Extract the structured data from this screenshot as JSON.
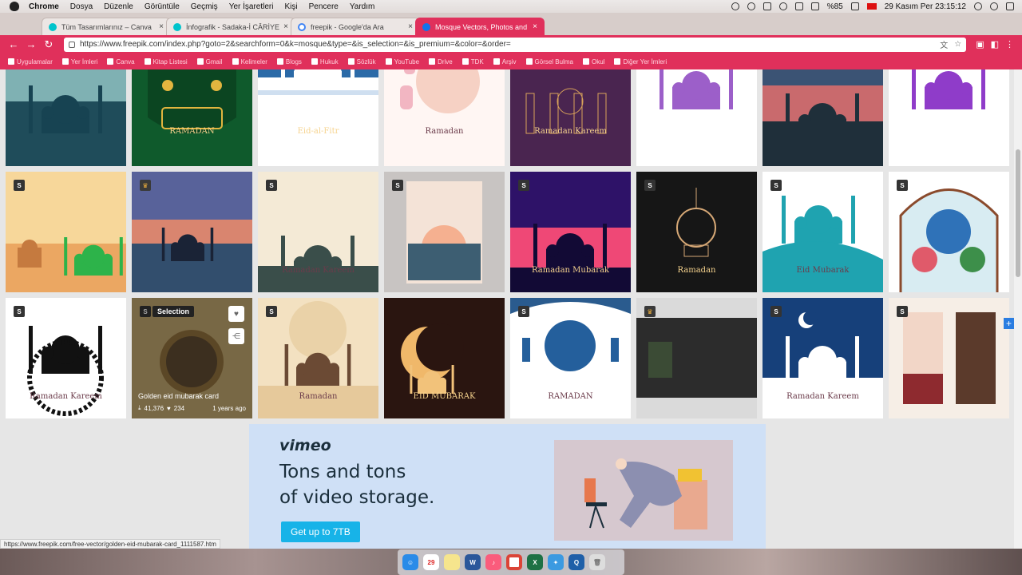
{
  "menubar": {
    "app": "Chrome",
    "items": [
      "Dosya",
      "Düzenle",
      "Görüntüle",
      "Geçmiş",
      "Yer İşaretleri",
      "Kişi",
      "Pencere",
      "Yardım"
    ],
    "battery": "%85",
    "datetime": "29 Kasım Per  23:15:12"
  },
  "tabs": [
    {
      "title": "Tüm Tasarımlarınız – Canva",
      "color": "#00c4cc"
    },
    {
      "title": "İnfografik - Sadaka-İ CÂRİYE",
      "color": "#00c4cc"
    },
    {
      "title": "freepik - Google'da Ara",
      "color": "#4285f4"
    },
    {
      "title": "Mosque Vectors, Photos and P",
      "color": "#1273eb",
      "active": true
    }
  ],
  "toolbar": {
    "url": "https://www.freepik.com/index.php?goto=2&searchform=0&k=mosque&type=&is_selection=&is_premium=&color=&order="
  },
  "bookmarks": [
    "Uygulamalar",
    "Yer İmleri",
    "Canva",
    "Kitap Listesi",
    "Gmail",
    "Kelimeler",
    "Blogs",
    "Hukuk",
    "Sözlük",
    "YouTube",
    "Drive",
    "TDK",
    "Arşiv",
    "Görsel Bulma",
    "Okul",
    "Diğer Yer İmleri"
  ],
  "cards": [
    {
      "art": "teal-dusk",
      "caption": "",
      "badge": ""
    },
    {
      "art": "green-ramadan",
      "caption": "RAMADAN",
      "badge": ""
    },
    {
      "art": "eid-blue",
      "caption": "Eid-al-Fitr",
      "badge": ""
    },
    {
      "art": "lantern-pink",
      "caption": "Ramadan",
      "badge": ""
    },
    {
      "art": "purple-line",
      "caption": "Ramadan Kareem",
      "badge": ""
    },
    {
      "art": "purple-mosque-white",
      "caption": "",
      "badge": ""
    },
    {
      "art": "sunset-silhouette",
      "caption": "",
      "badge": ""
    },
    {
      "art": "violet-mosque",
      "caption": "",
      "badge": ""
    },
    {
      "art": "desert-camels",
      "caption": "",
      "badge": "S"
    },
    {
      "art": "photo-dusk",
      "caption": "",
      "badge": "crown"
    },
    {
      "art": "kareem-card",
      "caption": "Ramadan Kareem",
      "badge": "S"
    },
    {
      "art": "poster-peach",
      "caption": "",
      "badge": "S"
    },
    {
      "art": "mubarak-neon",
      "caption": "Ramadan Mubarak",
      "badge": "S"
    },
    {
      "art": "dark-lantern",
      "caption": "Ramadan",
      "badge": "S"
    },
    {
      "art": "eid-teal-wave",
      "caption": "Eid Mubarak",
      "badge": "S"
    },
    {
      "art": "kids-mosque",
      "caption": "",
      "badge": "S"
    },
    {
      "art": "mandala-mosque",
      "caption": "Ramadan Kareem",
      "badge": "S"
    },
    {
      "art": "golden-eid",
      "caption": "",
      "badge": "",
      "hover": true
    },
    {
      "art": "beige-ramadan",
      "caption": "Ramadan",
      "badge": "S"
    },
    {
      "art": "dark-moon",
      "caption": "EID MUBARAK",
      "badge": ""
    },
    {
      "art": "blue-ramadan",
      "caption": "RAMADAN",
      "badge": "S"
    },
    {
      "art": "quran-photo",
      "caption": "",
      "badge": "crown"
    },
    {
      "art": "night-blue",
      "caption": "Ramadan Kareem",
      "badge": "S"
    },
    {
      "art": "banners",
      "caption": "",
      "badge": "S"
    }
  ],
  "hover": {
    "selection": "Selection",
    "title": "Golden eid mubarak card",
    "downloads": "41,376",
    "likes": "234",
    "ago": "1 years ago"
  },
  "ad": {
    "logo": "vimeo",
    "headline1": "Tons and tons",
    "headline2": "of video storage.",
    "cta": "Get up to 7TB"
  },
  "status": "https://www.freepik.com/free-vector/golden-eid-mubarak-card_1111587.htm"
}
